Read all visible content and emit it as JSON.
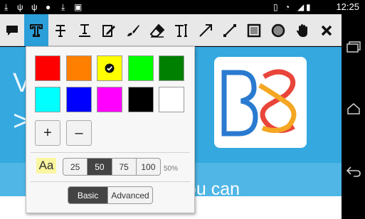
{
  "status_bar": {
    "time": "12:25",
    "icons": [
      "download-icon",
      "usb-icon",
      "usb-icon",
      "android-icon",
      "download-icon",
      "briefcase-icon",
      "vibrate-icon",
      "wifi-icon",
      "signal-icon",
      "battery-icon"
    ]
  },
  "toolbar": {
    "tools": [
      "comment-tool",
      "text-tool",
      "strikeout-tool",
      "underline-tool",
      "signature-tool",
      "pen-tool",
      "eraser-tool",
      "text-cursor-tool",
      "arrow-tool",
      "line-tool",
      "rectangle-tool",
      "ellipse-tool",
      "pan-tool",
      "close-tool"
    ],
    "active_tool": "text-tool",
    "accent_color": "#2b9fd9"
  },
  "background": {
    "text_v": "V",
    "text_chevron": ">",
    "text_you_can": "ou can",
    "color": "#34a8df"
  },
  "popup": {
    "colors": [
      "#ff0000",
      "#ff8000",
      "#ffff00",
      "#00ff00",
      "#008000",
      "#00ffff",
      "#0000ff",
      "#ff00ff",
      "#000000",
      "#ffffff"
    ],
    "selected_color": "#ffff00",
    "plus_label": "+",
    "minus_label": "–",
    "aa_label": "Aa",
    "sizes": [
      "25",
      "50",
      "75",
      "100"
    ],
    "selected_size": "50",
    "size_percent": "50%",
    "modes": {
      "basic": "Basic",
      "advanced": "Advanced"
    },
    "selected_mode": "Basic"
  }
}
